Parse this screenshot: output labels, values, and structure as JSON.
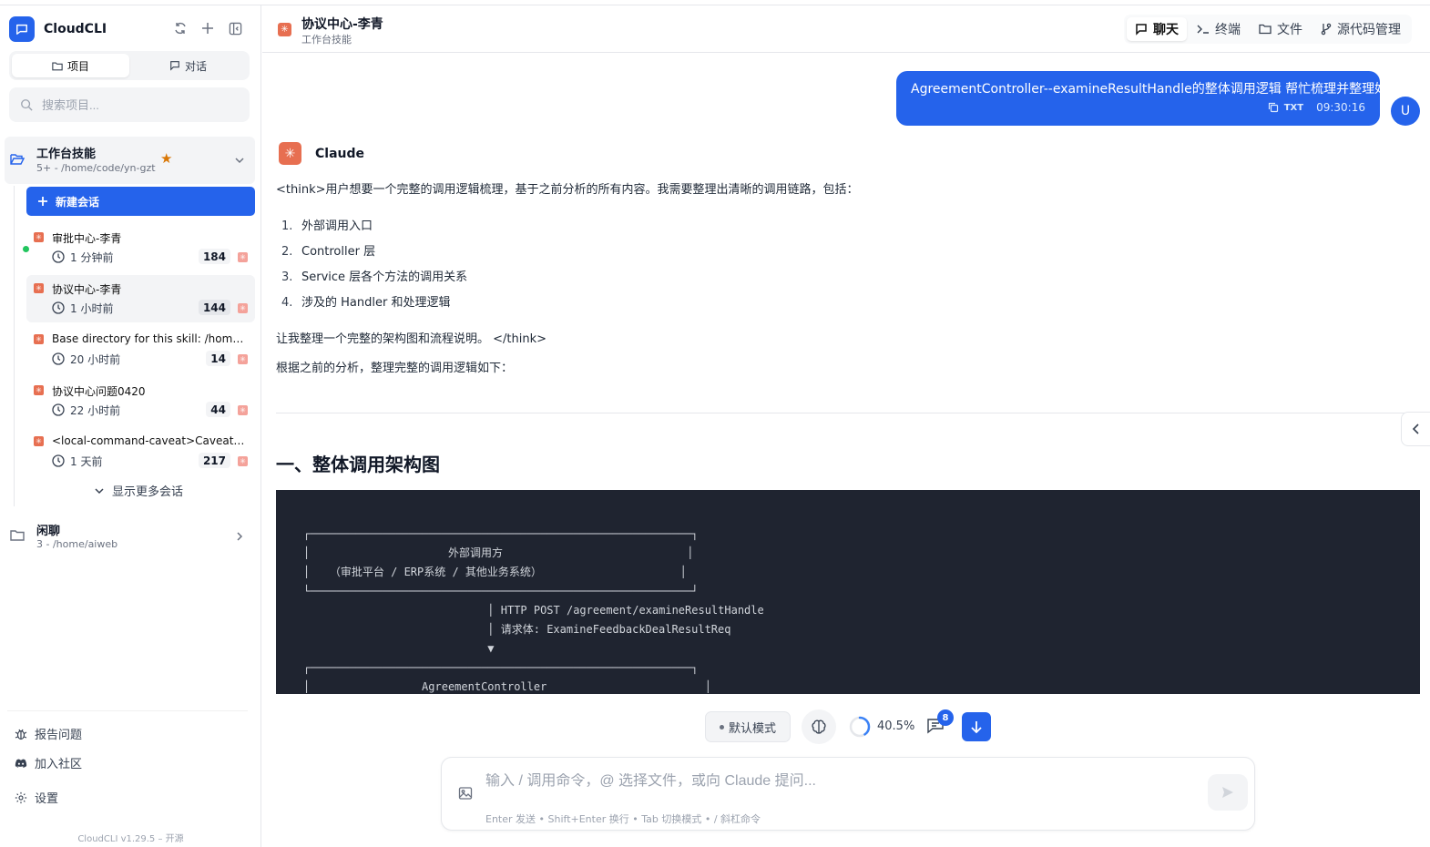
{
  "app": {
    "name": "CloudCLI",
    "version": "CloudCLI v1.29.5 – 开源"
  },
  "sidebar": {
    "tabs": [
      {
        "label": "项目"
      },
      {
        "label": "对话"
      }
    ],
    "search_placeholder": "搜索项目...",
    "project": {
      "name": "工作台技能",
      "count": "5+",
      "path": "- /home/code/yn-gzt"
    },
    "new_session": "新建会话",
    "sessions": [
      {
        "title": "审批中心-李青",
        "time": "1 分钟前",
        "count": "184",
        "active": true
      },
      {
        "title": "协议中心-李青",
        "time": "1 小时前",
        "count": "144",
        "selected": true
      },
      {
        "title": "Base directory for this skill: /home/...",
        "time": "20 小时前",
        "count": "14"
      },
      {
        "title": "协议中心问题0420",
        "time": "22 小时前",
        "count": "44"
      },
      {
        "title": "<local-command-caveat>Caveat: T...",
        "time": "1 天前",
        "count": "217"
      }
    ],
    "show_more": "显示更多会话",
    "project2": {
      "name": "闲聊",
      "count": "3",
      "path": "- /home/aiweb"
    },
    "footer": [
      {
        "label": "报告问题",
        "icon": "bug-icon"
      },
      {
        "label": "加入社区",
        "icon": "discord-icon"
      },
      {
        "label": "设置",
        "icon": "gear-icon"
      }
    ]
  },
  "header": {
    "title": "协议中心-李青",
    "subtitle": "工作台技能",
    "tabs": [
      {
        "label": "聊天",
        "active": true
      },
      {
        "label": "终端"
      },
      {
        "label": "文件"
      },
      {
        "label": "源代码管理"
      }
    ]
  },
  "chat": {
    "user_message": "AgreementController--examineResultHandle的整体调用逻辑 帮忙梳理并整理好",
    "user_meta_format": "TXT",
    "user_time": "09:30:16",
    "user_avatar": "U",
    "assistant_name": "Claude",
    "think_intro": "<think>用户想要一个完整的调用逻辑梳理，基于之前分析的所有内容。我需要整理出清晰的调用链路，包括：",
    "list": [
      {
        "n": "1.",
        "text": "外部调用入口"
      },
      {
        "n": "2.",
        "text": "Controller 层"
      },
      {
        "n": "3.",
        "text": "Service 层各个方法的调用关系"
      },
      {
        "n": "4.",
        "text": "涉及的 Handler 和处理逻辑"
      }
    ],
    "think_end": "让我整理一个完整的架构图和流程说明。 </think>",
    "lead": "根据之前的分析，整理完整的调用逻辑如下：",
    "heading": "一、整体调用架构图",
    "code": "┌──────────────────────────────────────────────────────────┐\n│                     外部调用方                            │\n│   （审批平台 / ERP系统 / 其他业务系统）                     │\n└──────────────────────────────────────────────────────────┘\n                            │ HTTP POST /agreement/examineResultHandle\n                            │ 请求体: ExamineFeedbackDealResultReq\n                            ▼\n┌──────────────────────────────────────────────────────────┐\n│                 AgreementController                        │"
  },
  "composer": {
    "mode": "默认模式",
    "context_pct": "40.5%",
    "context_fraction": 0.405,
    "badge": "8",
    "placeholder": "输入 / 调用命令，@ 选择文件，或向 Claude 提问...",
    "hint": "Enter 发送 • Shift+Enter 换行 • Tab 切换模式 • / 斜杠命令"
  },
  "colors": {
    "accent": "#2563eb",
    "claude": "#e76f51",
    "star": "#d97706",
    "online": "#22c55e"
  }
}
